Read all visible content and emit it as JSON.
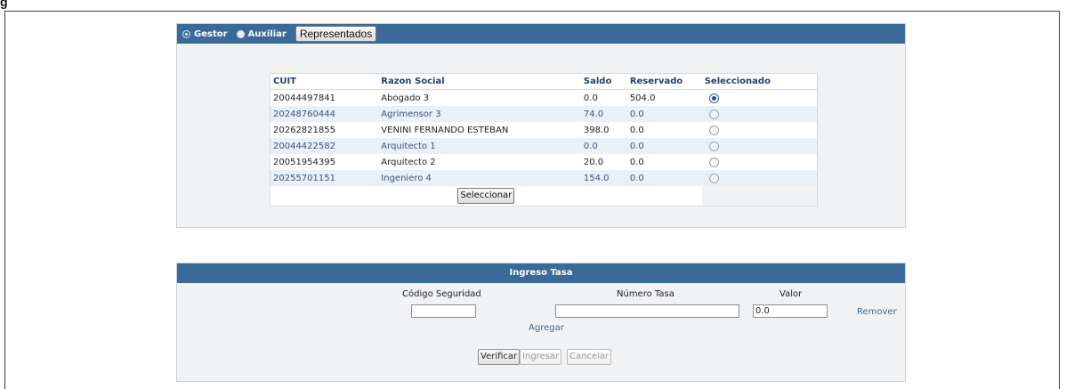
{
  "header_partial": "g",
  "top_bar": {
    "options": [
      {
        "label": "Gestor",
        "checked": true
      },
      {
        "label": "Auxiliar",
        "checked": false
      }
    ],
    "represent_button": "Representados"
  },
  "represented_table": {
    "columns": [
      "CUIT",
      "Razon Social",
      "Saldo",
      "Reservado",
      "Seleccionado"
    ],
    "rows": [
      {
        "cuit": "20044497841",
        "razon": "Abogado 3",
        "saldo": "0.0",
        "reservado": "504.0",
        "selected": true
      },
      {
        "cuit": "20248760444",
        "razon": "Agrimensor 3",
        "saldo": "74.0",
        "reservado": "0.0",
        "selected": false
      },
      {
        "cuit": "20262821855",
        "razon": "VENINI FERNANDO ESTEBAN",
        "saldo": "398.0",
        "reservado": "0.0",
        "selected": false
      },
      {
        "cuit": "20044422582",
        "razon": "Arquitecto 1",
        "saldo": "0.0",
        "reservado": "0.0",
        "selected": false
      },
      {
        "cuit": "20051954395",
        "razon": "Arquitecto 2",
        "saldo": "20.0",
        "reservado": "0.0",
        "selected": false
      },
      {
        "cuit": "20255701151",
        "razon": "Ingeniero 4",
        "saldo": "154.0",
        "reservado": "0.0",
        "selected": false
      }
    ],
    "select_button": "Seleccionar"
  },
  "ingreso_tasa": {
    "title": "Ingreso Tasa",
    "labels": {
      "codigo": "Código Seguridad",
      "numero": "Número Tasa",
      "valor": "Valor"
    },
    "values": {
      "codigo": "",
      "numero": "",
      "valor": "0.0"
    },
    "remove_link": "Remover",
    "add_link": "Agregar",
    "buttons": {
      "verify": "Verificar",
      "submit": "Ingresar",
      "cancel": "Cancelar"
    }
  }
}
